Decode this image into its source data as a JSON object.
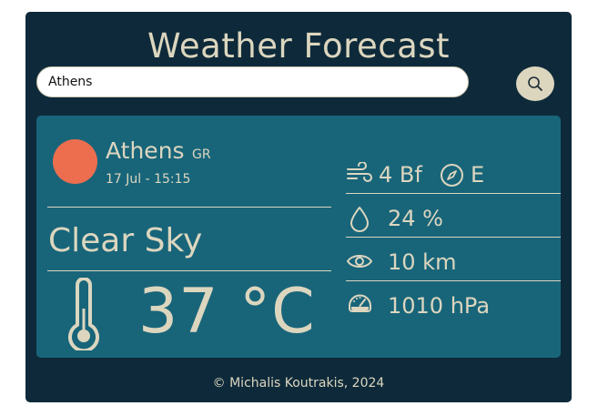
{
  "header": {
    "title": "Weather Forecast"
  },
  "search": {
    "value": "Athens",
    "button_icon": "search-icon"
  },
  "location": {
    "city": "Athens",
    "country": "GR",
    "datetime": "17 Jul - 15:15"
  },
  "weather": {
    "condition": "Clear Sky",
    "condition_icon": "sun-icon",
    "temperature": "37 °C"
  },
  "metrics": {
    "wind_speed": "4 Bf",
    "wind_direction": "E",
    "humidity": "24 %",
    "visibility": "10 km",
    "pressure": "1010 hPa"
  },
  "footer": {
    "text": "© Michalis Koutrakis, 2024"
  },
  "colors": {
    "app_background": "#0e2a3a",
    "card_background": "#18657a",
    "text": "#dcd6bf",
    "sun": "#ec6e4e"
  }
}
